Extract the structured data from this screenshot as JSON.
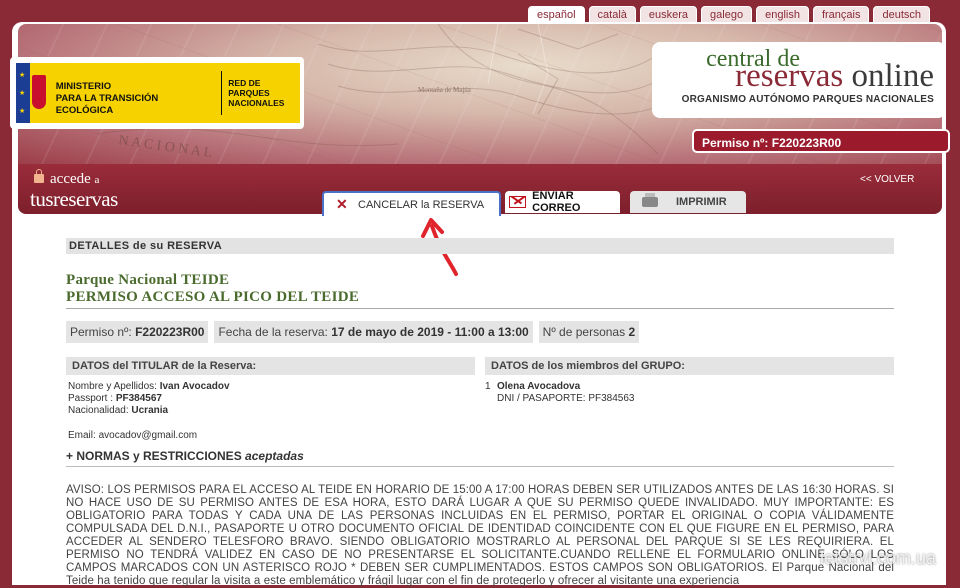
{
  "languages": [
    "español",
    "català",
    "euskera",
    "galego",
    "english",
    "français",
    "deutsch"
  ],
  "ministry": {
    "line1": "MINISTERIO",
    "line2": "PARA LA TRANSICIÓN ECOLÓGICA",
    "red_line1": "RED DE",
    "red_line2": "PARQUES",
    "red_line3": "NACIONALES"
  },
  "central": {
    "line1": "central de",
    "line2_a": "reservas",
    "line2_b": " online",
    "line3": "ORGANISMO AUTÓNOMO PARQUES NACIONALES"
  },
  "permit_badge": "Permiso nº: F220223R00",
  "accede": {
    "line1": "accede",
    "line1_small": "a",
    "line2": "tusreservas"
  },
  "volver": "<< VOLVER",
  "actions": {
    "cancel": "CANCELAR la RESERVA",
    "mail": "ENVIAR CORREO",
    "print": "IMPRIMIR"
  },
  "section_title": "DETALLES de su RESERVA",
  "park": {
    "name": "Parque Nacional TEIDE",
    "permit": "PERMISO ACCESO AL PICO DEL TEIDE"
  },
  "summary": {
    "permit_label": "Permiso nº:",
    "permit_value": "F220223R00",
    "date_label": "Fecha de la reserva:",
    "date_value": "17 de mayo de 2019 - 11:00 a 13:00",
    "persons_label": "Nº de personas",
    "persons_value": "2"
  },
  "holder": {
    "heading": "DATOS del TITULAR de la Reserva:",
    "name_label": "Nombre y Apellidos:",
    "name_value": "Ivan Avocadov",
    "passport_label": "Passport :",
    "passport_value": "PF384567",
    "nationality_label": "Nacionalidad:",
    "nationality_value": "Ucrania",
    "email_label": "Email:",
    "email_value": "avocadov@gmail.com"
  },
  "group": {
    "heading": "DATOS de los miembros del GRUPO:",
    "members": [
      {
        "num": "1",
        "name": "Olena Avocadova",
        "doc_label": "DNI / PASAPORTE:",
        "doc_value": "PF384563"
      }
    ]
  },
  "normas": {
    "prefix": "+ NORMAS y RESTRICCIONES",
    "accepted": "aceptadas"
  },
  "aviso": "AVISO: LOS PERMISOS PARA EL ACCESO AL TEIDE EN HORARIO DE 15:00 A 17:00 HORAS DEBEN SER UTILIZADOS ANTES DE LAS 16:30 HORAS. SI NO HACE USO DE SU PERMISO ANTES DE ESA HORA, ESTO DARÁ LUGAR A QUE SU PERMISO QUEDE INVALIDADO. MUY IMPORTANTE: ES OBLIGATORIO PARA TODAS Y CADA UNA DE LAS PERSONAS INCLUIDAS EN EL PERMISO, PORTAR EL ORIGINAL O COPIA VÁLIDAMENTE COMPULSADA DEL D.N.I., PASAPORTE U OTRO DOCUMENTO OFICIAL DE IDENTIDAD COINCIDENTE CON EL QUE FIGURE EN EL PERMISO, PARA ACCEDER AL SENDERO TELESFORO BRAVO. SIENDO OBLIGATORIO MOSTRARLO AL PERSONAL DEL PARQUE SI SE LES REQUIRIERA. EL PERMISO NO TENDRÁ VALIDEZ EN CASO DE NO PRESENTARSE EL SOLICITANTE.CUANDO RELLENE EL FORMULARIO ONLINE SÓLO LOS CAMPOS MARCADOS CON UN ASTERISCO ROJO * DEBEN SER CUMPLIMENTADOS. ESTOS CAMPOS SON OBLIGATORIOS. El Parque Nacional del Teide ha tenido que regular la visita a este emblemático y frágil lugar con el fin de protegerlo y ofrecer al visitante una experiencia",
  "watermark": "letstrvl.com.ua"
}
